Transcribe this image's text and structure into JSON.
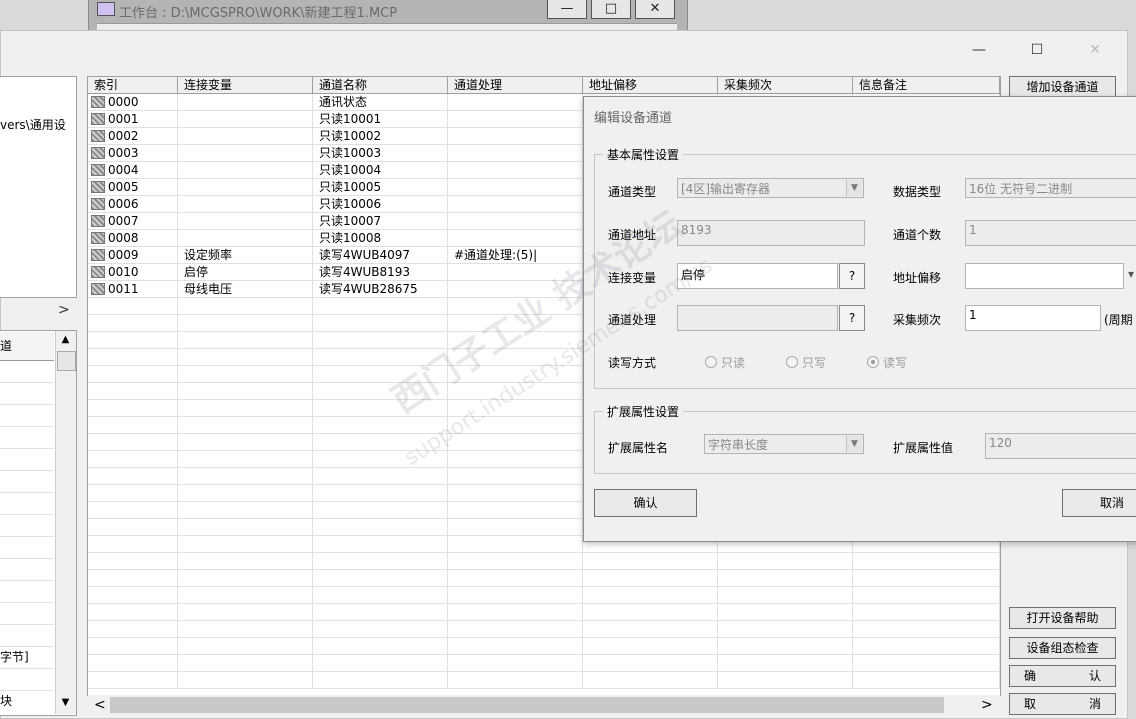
{
  "background_window": {
    "title": "工作台 : D:\\MCGSPRO\\WORK\\新建工程1.MCP",
    "min_label": "—",
    "max_label": "□",
    "close_label": "✕"
  },
  "main_window": {
    "min_label": "—",
    "max_label": "☐",
    "close_label": "✕"
  },
  "left_panel": {
    "path_text": "vers\\通用设",
    "scroll_right_label": ">",
    "header": "道",
    "rows": [
      "",
      "",
      "",
      "",
      "",
      "",
      "",
      "",
      "",
      "",
      "",
      "",
      "",
      "字节]",
      "",
      "块",
      ""
    ],
    "scroll_up": "▲",
    "scroll_down": "▼"
  },
  "table": {
    "columns": [
      "索引",
      "连接变量",
      "通道名称",
      "通道处理",
      "地址偏移",
      "采集频次",
      "信息备注"
    ],
    "rows": [
      [
        "0000",
        "",
        "通讯状态",
        ""
      ],
      [
        "0001",
        "",
        "只读10001",
        ""
      ],
      [
        "0002",
        "",
        "只读10002",
        ""
      ],
      [
        "0003",
        "",
        "只读10003",
        ""
      ],
      [
        "0004",
        "",
        "只读10004",
        ""
      ],
      [
        "0005",
        "",
        "只读10005",
        ""
      ],
      [
        "0006",
        "",
        "只读10006",
        ""
      ],
      [
        "0007",
        "",
        "只读10007",
        ""
      ],
      [
        "0008",
        "",
        "只读10008",
        ""
      ],
      [
        "0009",
        "设定频率",
        "读写4WUB4097",
        "#通道处理:(5)|"
      ],
      [
        "0010",
        "启停",
        "读写4WUB8193",
        ""
      ],
      [
        "0011",
        "母线电压",
        "读写4WUB28675",
        ""
      ]
    ],
    "scroll_left": "<",
    "scroll_right": ">"
  },
  "right_buttons": {
    "add_channel": "增加设备通道",
    "open_help": "打开设备帮助",
    "config_check": "设备组态检查",
    "confirm_left": "确",
    "confirm_right": "认",
    "cancel_left": "取",
    "cancel_right": "消"
  },
  "dialog": {
    "title": "编辑设备通道",
    "basic_group": "基本属性设置",
    "channel_type_label": "通道类型",
    "channel_type_value": "[4区]输出寄存器",
    "data_type_label": "数据类型",
    "data_type_value": "16位 无符号二进制",
    "channel_addr_label": "通道地址",
    "channel_addr_value": "8193",
    "channel_count_label": "通道个数",
    "channel_count_value": "1",
    "link_var_label": "连接变量",
    "link_var_value": "启停",
    "addr_offset_label": "地址偏移",
    "addr_offset_value": "",
    "channel_proc_label": "通道处理",
    "channel_proc_value": "",
    "sample_freq_label": "采集频次",
    "sample_freq_value": "1",
    "sample_freq_unit": "(周期",
    "q_label": "?",
    "rw_label": "读写方式",
    "rw_options": [
      "只读",
      "只写",
      "读写"
    ],
    "rw_selected": "读写",
    "ext_group": "扩展属性设置",
    "ext_name_label": "扩展属性名",
    "ext_name_value": "字符串长度",
    "ext_value_label": "扩展属性值",
    "ext_value_value": "120",
    "confirm": "确认",
    "cancel": "取消"
  },
  "watermark": {
    "line1": "西门子工业 技术论坛",
    "line2": "support.industry.siemens.com/cs"
  }
}
